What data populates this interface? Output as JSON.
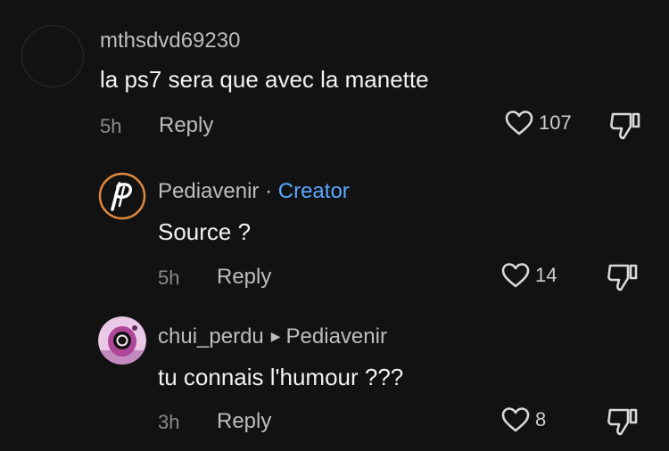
{
  "comments": [
    {
      "username": "mthsdvd69230",
      "text": "la ps7 sera que avec la manette",
      "time": "5h",
      "reply_label": "Reply",
      "likes": "107"
    },
    {
      "username": "Pediavenir",
      "separator": "·",
      "badge": "Creator",
      "text": "Source ?",
      "time": "5h",
      "reply_label": "Reply",
      "likes": "14"
    },
    {
      "username": "chui_perdu",
      "reply_to": "Pediavenir",
      "text": "tu connais l'humour ???",
      "time": "3h",
      "reply_label": "Reply",
      "likes": "8"
    }
  ],
  "colors": {
    "background": "#121212",
    "creator_badge": "#5aa7ff",
    "avatar_accent": "#e0893e"
  },
  "icons": {
    "like": "heart-outline-icon",
    "dislike": "thumbs-down-icon",
    "reply_arrow": "triangle-right-icon"
  }
}
